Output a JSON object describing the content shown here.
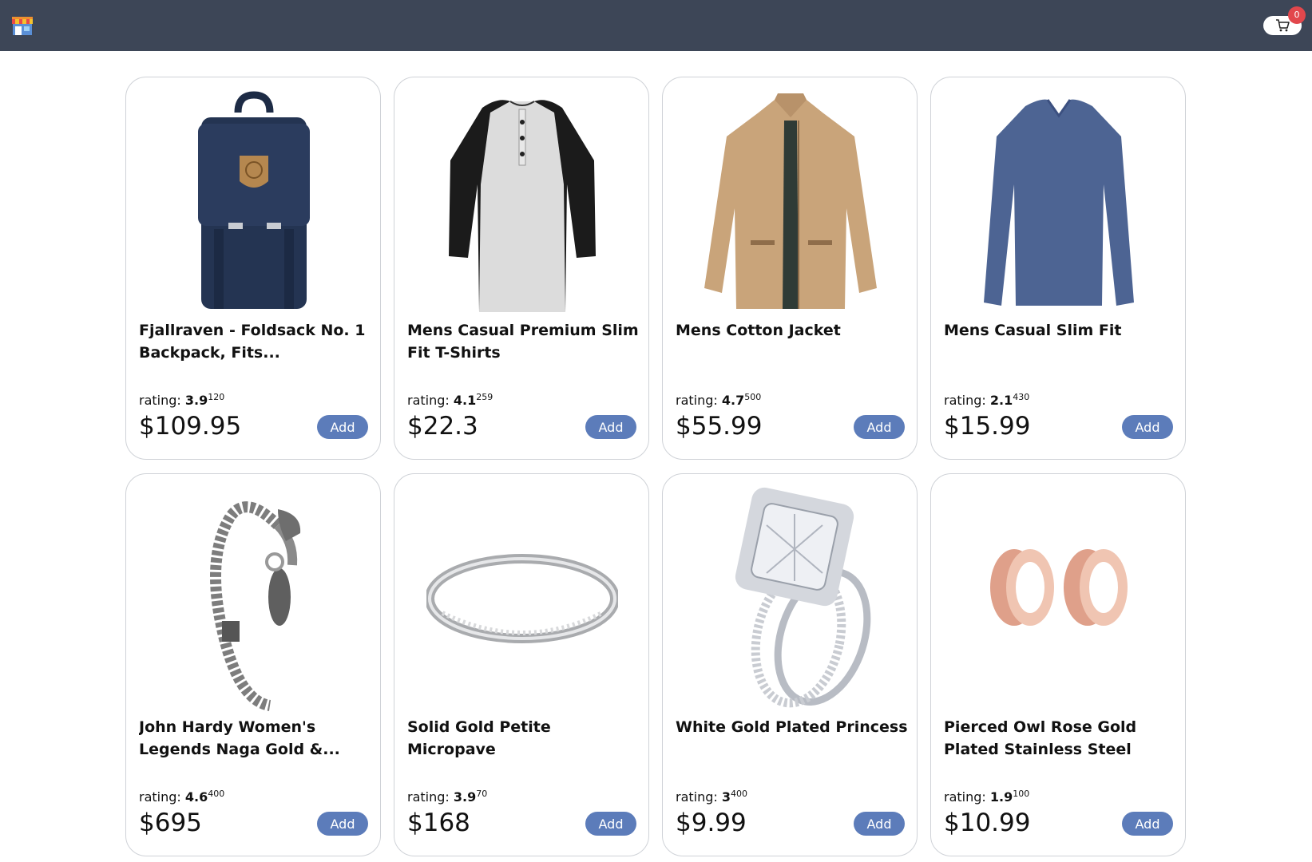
{
  "header": {
    "logo_icon": "storefront-icon",
    "cart_icon": "shopping-cart-icon",
    "cart_count": "0"
  },
  "products": [
    {
      "title": "Fjallraven - Foldsack No. 1 Backpack, Fits...",
      "rating_label": "rating: ",
      "rating": "3.9",
      "rating_count": "120",
      "price": "$109.95",
      "add_label": "Add",
      "image_icon": "backpack-image"
    },
    {
      "title": "Mens Casual Premium Slim Fit T-Shirts",
      "rating_label": "rating: ",
      "rating": "4.1",
      "rating_count": "259",
      "price": "$22.3",
      "add_label": "Add",
      "image_icon": "tshirt-image"
    },
    {
      "title": "Mens Cotton Jacket",
      "rating_label": "rating: ",
      "rating": "4.7",
      "rating_count": "500",
      "price": "$55.99",
      "add_label": "Add",
      "image_icon": "jacket-image"
    },
    {
      "title": "Mens Casual Slim Fit",
      "rating_label": "rating: ",
      "rating": "2.1",
      "rating_count": "430",
      "price": "$15.99",
      "add_label": "Add",
      "image_icon": "longsleeve-shirt-image"
    },
    {
      "title": "John Hardy Women's Legends Naga Gold &...",
      "rating_label": "rating: ",
      "rating": "4.6",
      "rating_count": "400",
      "price": "$695",
      "add_label": "Add",
      "image_icon": "bracelet-image"
    },
    {
      "title": "Solid Gold Petite Micropave",
      "rating_label": "rating: ",
      "rating": "3.9",
      "rating_count": "70",
      "price": "$168",
      "add_label": "Add",
      "image_icon": "ring-image"
    },
    {
      "title": "White Gold Plated Princess",
      "rating_label": "rating: ",
      "rating": "3",
      "rating_count": "400",
      "price": "$9.99",
      "add_label": "Add",
      "image_icon": "diamond-ring-image"
    },
    {
      "title": "Pierced Owl Rose Gold Plated Stainless Steel Double",
      "rating_label": "rating: ",
      "rating": "1.9",
      "rating_count": "100",
      "price": "$10.99",
      "add_label": "Add",
      "image_icon": "ear-plugs-image"
    }
  ],
  "colors": {
    "header_bg": "#3d4657",
    "add_button": "#5c7cba",
    "badge": "#e2474c"
  }
}
